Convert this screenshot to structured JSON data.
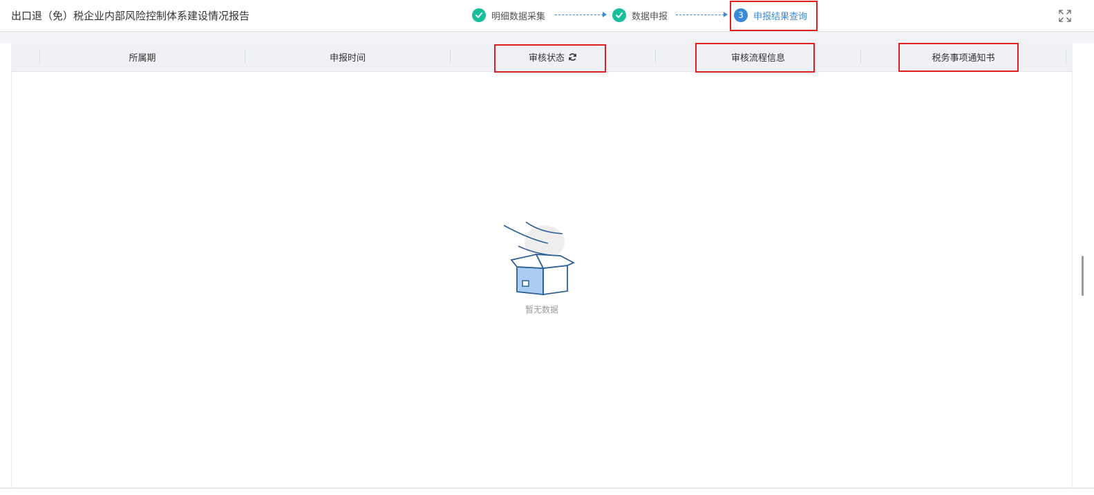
{
  "header": {
    "title": "出口退（免）税企业内部风险控制体系建设情况报告",
    "steps": [
      {
        "label": "明细数据采集",
        "status": "done"
      },
      {
        "label": "数据申报",
        "status": "done"
      },
      {
        "label": "申报结果查询",
        "status": "current",
        "number": "3"
      }
    ],
    "fullscreen_icon": "expand-icon"
  },
  "table": {
    "columns": [
      "所属期",
      "申报时间",
      "审核状态",
      "审核流程信息",
      "税务事项通知书"
    ],
    "rows": []
  },
  "empty_state": {
    "text": "暂无数据",
    "icon": "empty-box-icon"
  },
  "colors": {
    "accent": "#3d8bd8",
    "done": "#19be9b",
    "highlight_box": "#e02020",
    "header_bg": "#f0f1f5"
  }
}
